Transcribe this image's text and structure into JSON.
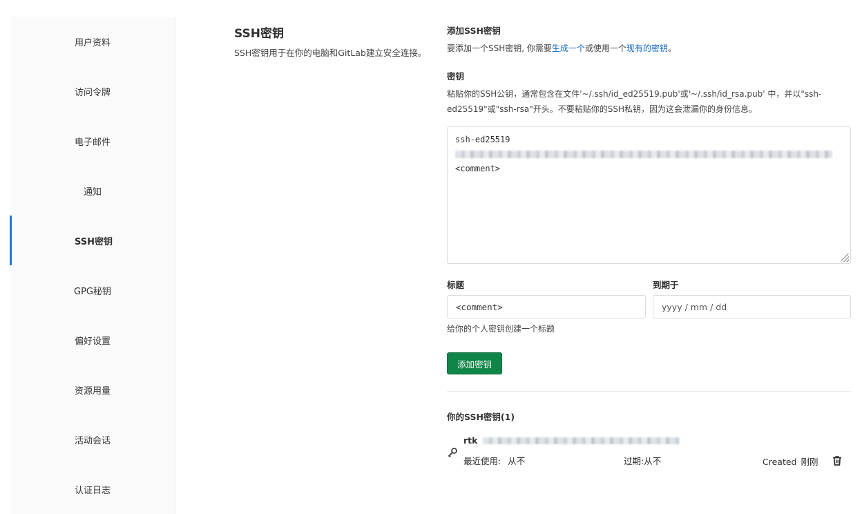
{
  "sidebar": {
    "items": [
      {
        "label": "用户资料"
      },
      {
        "label": "访问令牌"
      },
      {
        "label": "电子邮件"
      },
      {
        "label": "通知"
      },
      {
        "label": "SSH密钥"
      },
      {
        "label": "GPG秘钥"
      },
      {
        "label": "偏好设置"
      },
      {
        "label": "资源用量"
      },
      {
        "label": "活动会话"
      },
      {
        "label": "认证日志"
      }
    ],
    "active_index": 4
  },
  "intro": {
    "title": "SSH密钥",
    "description": "SSH密钥用于在你的电脑和GitLab建立安全连接。"
  },
  "add_key": {
    "heading": "添加SSH密钥",
    "text_prefix": "要添加一个SSH密钥, 你需要",
    "link_generate": "生成一个",
    "text_middle": "或使用一个",
    "link_existing": "现有的密钥",
    "text_suffix": "。",
    "key_label": "密钥",
    "key_help": "粘贴你的SSH公钥，通常包含在文件'~/.ssh/id_ed25519.pub'或'~/.ssh/id_rsa.pub' 中，并以\"ssh-ed25519\"或\"ssh-rsa\"开头。不要粘贴你的SSH私钥，因为这会泄漏你的身份信息。",
    "key_line1": "ssh-ed25519",
    "key_line3": "<comment>",
    "title_label": "标题",
    "title_value": "<comment>",
    "expires_label": "到期于",
    "expires_placeholder": "yyyy / mm / dd",
    "title_help": "给你的个人密钥创建一个标题",
    "submit_label": "添加密钥"
  },
  "keys_list": {
    "heading": "你的SSH密钥(1)",
    "items": [
      {
        "name": "rtk",
        "last_used_label": "最近使用:",
        "last_used_value": "从不",
        "expires_label": "过期:",
        "expires_value": "从不",
        "created_label": "Created",
        "created_value": "刚刚"
      }
    ]
  },
  "colors": {
    "accent_link": "#1068bf",
    "primary_button": "#108548",
    "active_indicator": "#1f78d1"
  },
  "icons": [
    "key-icon",
    "trash-icon",
    "resize-grip-icon"
  ]
}
